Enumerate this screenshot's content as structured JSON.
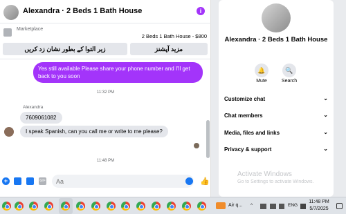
{
  "chat": {
    "title": "Alexandra · 2 Beds 1 Bath House",
    "info_icon": "info-icon",
    "marketplace": {
      "label": "Marketplace",
      "listing": "2 Beds 1 Bath House - $800",
      "btn_send_location": "زیر التوا کے بطور نشان زد کریں",
      "btn_more_actions": "مزید آپشنز"
    },
    "messages": {
      "outgoing_1": "Yes still available Please share your phone number and I'll get back to you soon",
      "timestamp_1": "11:32 PM",
      "sender": "Alexandra",
      "incoming_1": "7609061082",
      "incoming_2": "I speak Spanish, can you call me or write to me please?",
      "timestamp_2": "11:48 PM"
    },
    "composer": {
      "placeholder": "Aa",
      "gif_label": "GIF",
      "plus_label": "+",
      "like_icon": "👍"
    }
  },
  "info_panel": {
    "title": "Alexandra · 2 Beds 1 Bath House",
    "actions": [
      {
        "label": "Mute",
        "icon": "bell-icon",
        "glyph": "🔔"
      },
      {
        "label": "Search",
        "icon": "search-icon",
        "glyph": "🔍"
      }
    ],
    "sections": [
      {
        "label": "Customize chat"
      },
      {
        "label": "Chat members"
      },
      {
        "label": "Media, files and links"
      },
      {
        "label": "Privacy & support"
      }
    ],
    "chevron": "⌄",
    "watermark_title": "Activate Windows",
    "watermark_sub": "Go to Settings to activate Windows."
  },
  "taskbar": {
    "weather": "Air q...",
    "tray_chevron": "^",
    "language": "ENG",
    "time": "11:48 PM",
    "date": "5/7/2025"
  },
  "colors": {
    "accent": "#a334fa",
    "messenger_blue": "#1877f2"
  }
}
